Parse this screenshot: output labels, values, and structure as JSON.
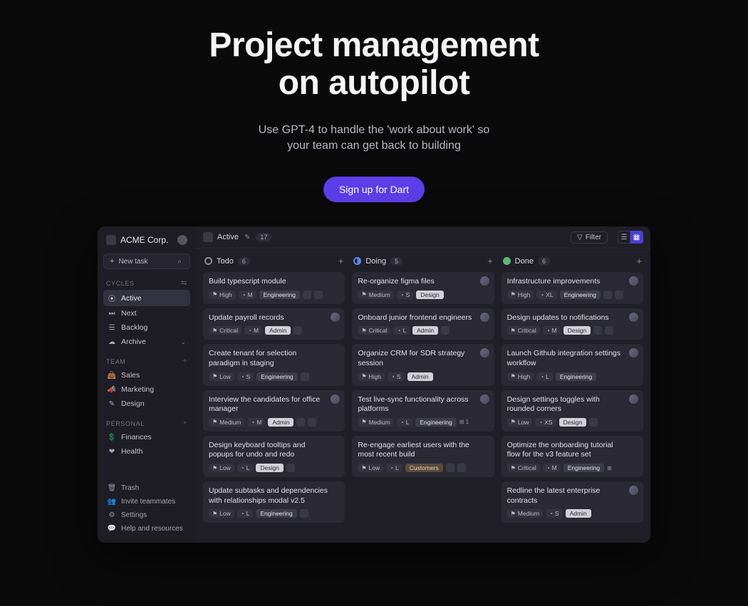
{
  "hero": {
    "title_line1": "Project management",
    "title_line2": "on autopilot",
    "subtitle_line1": "Use GPT-4 to handle the 'work about work' so",
    "subtitle_line2": "your team can get back to building",
    "cta": "Sign up for Dart"
  },
  "workspace": {
    "name": "ACME Corp."
  },
  "newtask": {
    "label": "New task"
  },
  "sections": {
    "cycles": {
      "label": "CYCLES"
    },
    "team": {
      "label": "TEAM"
    },
    "personal": {
      "label": "PERSONAL"
    }
  },
  "nav": {
    "cycles": [
      {
        "icon": "⦿",
        "label": "Active",
        "active": true
      },
      {
        "icon": "⏭",
        "label": "Next"
      },
      {
        "icon": "☰",
        "label": "Backlog"
      },
      {
        "icon": "☁",
        "label": "Archive",
        "chev": true
      }
    ],
    "team": [
      {
        "icon": "👜",
        "label": "Sales"
      },
      {
        "icon": "📣",
        "label": "Marketing"
      },
      {
        "icon": "✎",
        "label": "Design"
      }
    ],
    "personal": [
      {
        "icon": "💲",
        "label": "Finances"
      },
      {
        "icon": "❤",
        "label": "Health"
      }
    ]
  },
  "footer": [
    {
      "icon": "🗑",
      "label": "Trash"
    },
    {
      "icon": "👥",
      "label": "Invite teammates"
    },
    {
      "icon": "⚙",
      "label": "Settings"
    },
    {
      "icon": "💬",
      "label": "Help and resources"
    }
  ],
  "topbar": {
    "crumb": "Active",
    "count": "17",
    "filter": "Filter"
  },
  "board": {
    "columns": [
      {
        "status": "todo",
        "title": "Todo",
        "count": "6",
        "cards": [
          {
            "title": "Build typescript module",
            "priority": "High",
            "size": "M",
            "tag": "Engineering",
            "tag_style": "",
            "extras": [
              "link",
              "more"
            ]
          },
          {
            "title": "Update payroll records",
            "priority": "Critical",
            "size": "M",
            "tag": "Admin",
            "tag_style": "light",
            "extras": [
              "more"
            ],
            "avatar": true
          },
          {
            "title": "Create tenant for selection paradigm in staging",
            "priority": "Low",
            "size": "S",
            "tag": "Engineering",
            "tag_style": "",
            "extras": [
              "more"
            ]
          },
          {
            "title": "Interview the candidates for office manager",
            "priority": "Medium",
            "size": "M",
            "tag": "Admin",
            "tag_style": "light",
            "extras": [
              "more",
              "link"
            ],
            "avatar": true
          },
          {
            "title": "Design keyboard tooltips and popups for undo and redo",
            "priority": "Low",
            "size": "L",
            "tag": "Design",
            "tag_style": "light",
            "extras": [
              "more"
            ]
          },
          {
            "title": "Update subtasks and dependencies with relationships modal v2.5",
            "priority": "Low",
            "size": "L",
            "tag": "Engineering",
            "tag_style": "",
            "extras": [
              "more"
            ]
          }
        ]
      },
      {
        "status": "doing",
        "title": "Doing",
        "count": "5",
        "cards": [
          {
            "title": "Re-organize figma files",
            "priority": "Medium",
            "size": "S",
            "tag": "Design",
            "tag_style": "light",
            "extras": [],
            "avatar": true
          },
          {
            "title": "Onboard junior frontend engineers",
            "priority": "Critical",
            "size": "L",
            "tag": "Admin",
            "tag_style": "light",
            "extras": [
              "more"
            ],
            "avatar": true
          },
          {
            "title": "Organize CRM for SDR strategy session",
            "priority": "High",
            "size": "S",
            "tag": "Admin",
            "tag_style": "light",
            "extras": [],
            "avatar": true
          },
          {
            "title": "Test live-sync functionality across platforms",
            "priority": "Medium",
            "size": "L",
            "tag": "Engineering",
            "tag_style": "",
            "extras": [],
            "extras_txt": "⊞ 1",
            "avatar": true
          },
          {
            "title": "Re-engage earliest users with the most recent build",
            "priority": "Low",
            "size": "L",
            "tag": "Customers",
            "tag_style": "cust",
            "extras": [
              "more",
              "link"
            ]
          }
        ]
      },
      {
        "status": "done",
        "title": "Done",
        "count": "6",
        "cards": [
          {
            "title": "Infrastructure improvements",
            "priority": "High",
            "size": "XL",
            "tag": "Engineering",
            "tag_style": "",
            "extras": [
              "link",
              "more"
            ],
            "avatar": true
          },
          {
            "title": "Design updates to notifications",
            "priority": "Critical",
            "size": "M",
            "tag": "Design",
            "tag_style": "light",
            "extras": [
              "more",
              "link"
            ],
            "avatar": true
          },
          {
            "title": "Launch Github integration settings workflow",
            "priority": "High",
            "size": "L",
            "tag": "Engineering",
            "tag_style": "",
            "extras": [],
            "avatar": true
          },
          {
            "title": "Design settings toggles with rounded corners",
            "priority": "Low",
            "size": "XS",
            "tag": "Design",
            "tag_style": "light",
            "extras": [
              "more"
            ],
            "avatar": true
          },
          {
            "title": "Optimize the onboarding tutorial flow for the v3 feature set",
            "priority": "Critical",
            "size": "M",
            "tag": "Engineering",
            "tag_style": "",
            "extras": [],
            "extras_txt": "⊞"
          },
          {
            "title": "Redline the latest enterprise contracts",
            "priority": "Medium",
            "size": "S",
            "tag": "Admin",
            "tag_style": "light",
            "extras": [],
            "avatar": true
          }
        ]
      }
    ]
  }
}
